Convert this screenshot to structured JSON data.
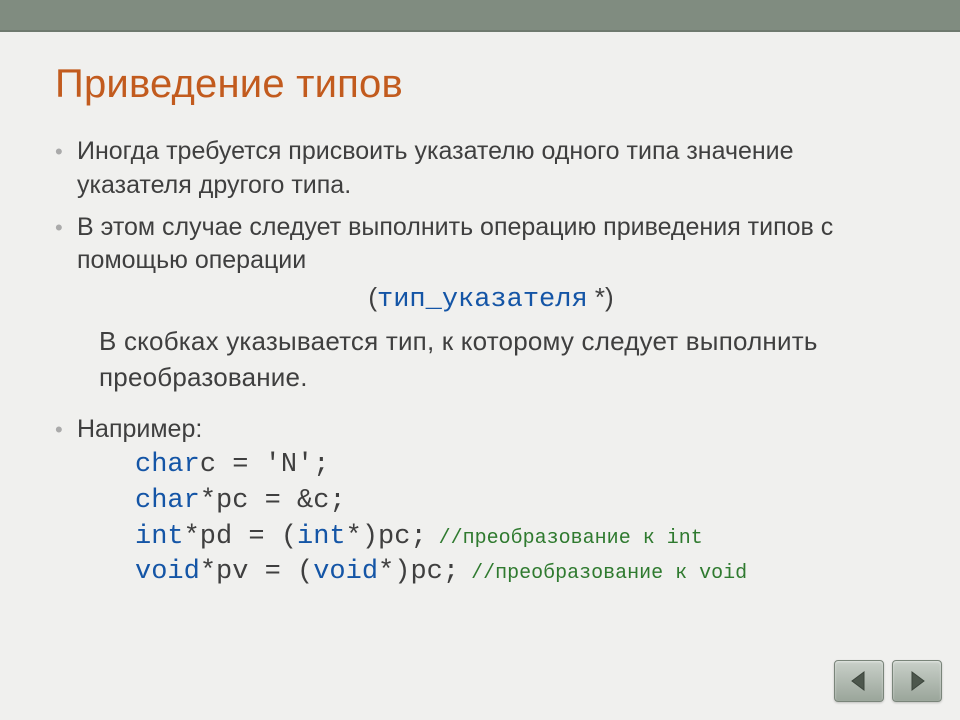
{
  "title": "Приведение типов",
  "bullets": {
    "b1": "Иногда требуется присвоить указателю одного типа значение указателя другого типа.",
    "b2": "В этом случае следует выполнить операцию приведения типов с помощью операции"
  },
  "cast_syntax": {
    "open": "(",
    "kw": "тип_указателя",
    "close": " *)"
  },
  "explain": "В скобках указывается тип, к которому следует выполнить преобразование.",
  "b3": "Например:",
  "code": {
    "l1_kw": "char",
    "l1_rest": "c = 'N';",
    "l2_kw": "char",
    "l2_rest": "*pc = &c;",
    "l3_kw": "int",
    "l3_mid": "*pd = (",
    "l3_kw2": "int",
    "l3_rest": "*)pc;",
    "l3_cmt": " //преобразование к int",
    "l4_kw": "void",
    "l4_mid": "*pv = (",
    "l4_kw2": "void",
    "l4_rest": "*)pc;",
    "l4_cmt": " //преобразование к void"
  },
  "nav": {
    "prev": "previous",
    "next": "next"
  }
}
